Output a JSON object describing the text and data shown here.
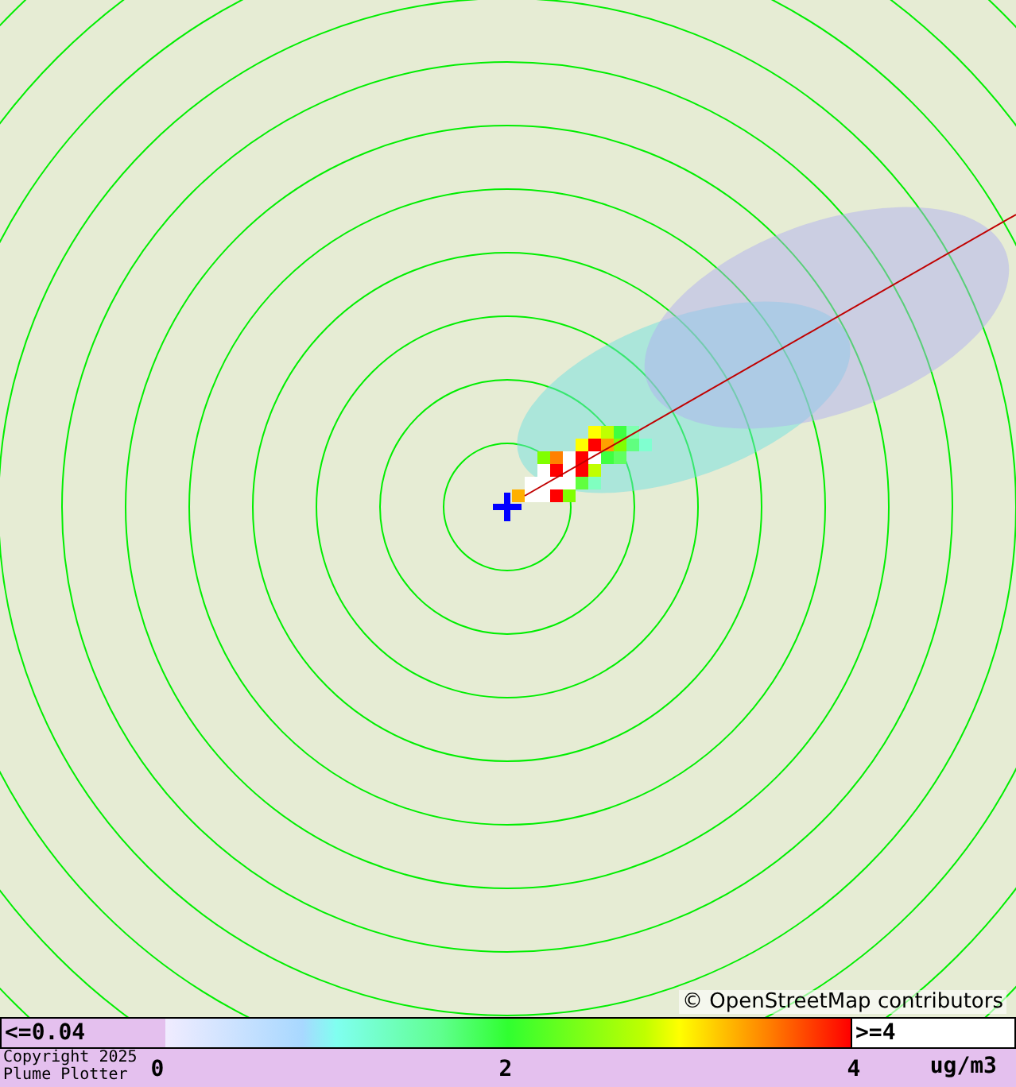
{
  "map": {
    "attribution": "© OpenStreetMap contributors"
  },
  "legend": {
    "min_label": "<=0.04",
    "max_label": ">=4",
    "ticks": [
      "0",
      "2",
      "4"
    ],
    "unit": "ug/m3"
  },
  "footer": {
    "lines": [
      "Copyright 2025",
      "Plume Plotter"
    ]
  }
}
